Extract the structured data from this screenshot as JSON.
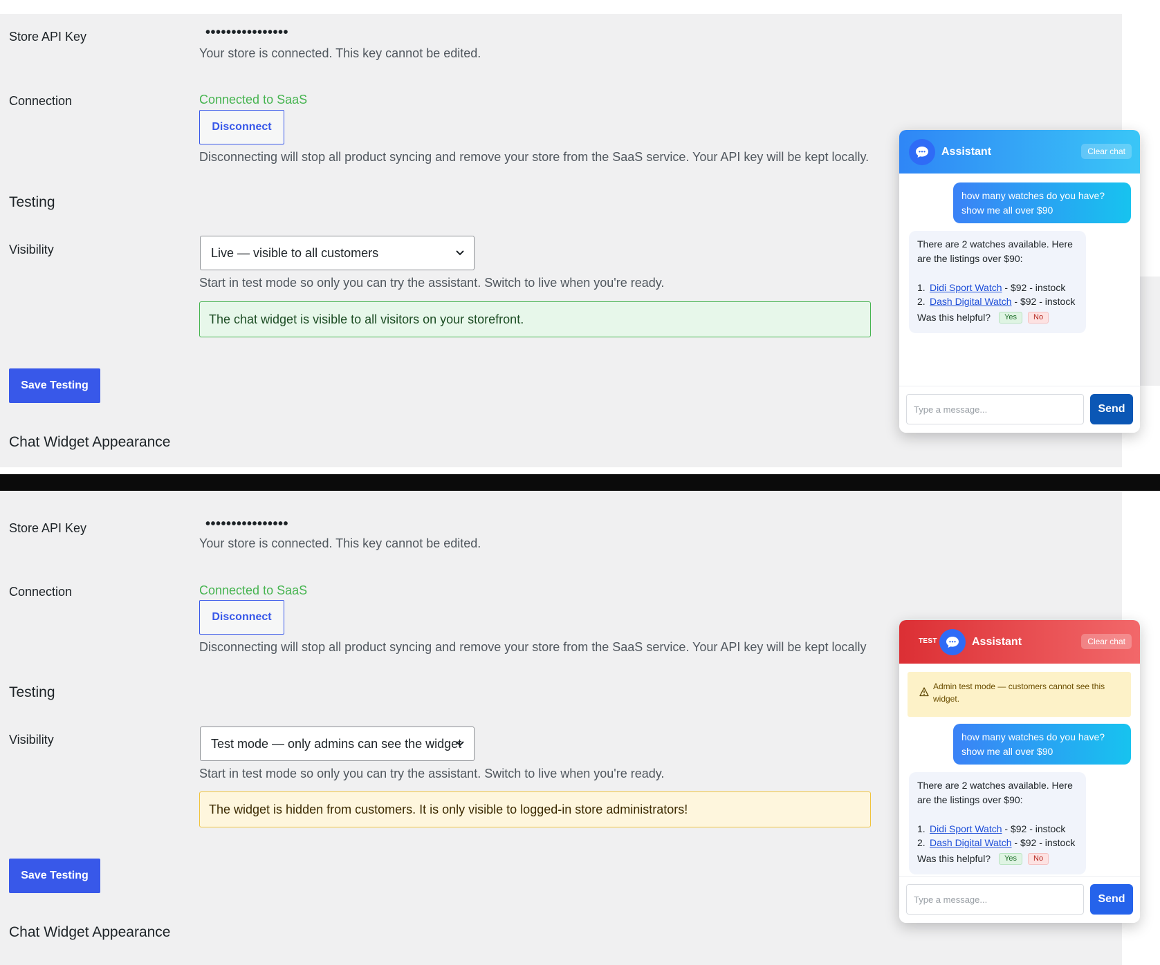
{
  "settings": {
    "api_key_label": "Store API Key",
    "api_key_masked": "••••••••••••••••",
    "api_key_desc": "Your store is connected. This key cannot be edited.",
    "connection_label": "Connection",
    "connection_status": "Connected to SaaS",
    "disconnect_label": "Disconnect",
    "testing_title": "Testing",
    "visibility_label": "Visibility",
    "visibility_desc": "Start in test mode so only you can try the assistant. Switch to live when you're ready.",
    "save_label": "Save Testing",
    "appearance_title": "Chat Widget Appearance"
  },
  "top": {
    "disconnect_desc": "Disconnecting will stop all product syncing and remove your store from the SaaS service. Your API key will be kept locally.",
    "visibility_value": "Live — visible to all customers",
    "notice": "The chat widget is visible to all visitors on your storefront."
  },
  "bottom": {
    "disconnect_desc": "Disconnecting will stop all product syncing and remove your store from the SaaS service. Your API key will be kept locally",
    "visibility_value": "Test mode — only admins can see the widget",
    "notice": "The widget is hidden from customers. It is only visible to logged-in store administrators!"
  },
  "widget": {
    "title": "Assistant",
    "clear_label": "Clear chat",
    "test_tag": "TEST",
    "test_banner": "Admin test mode — customers cannot see this widget.",
    "user_message": "how many watches do you have? show me all over $90",
    "bot_intro": "There are 2 watches available. Here are the listings over $90:",
    "products": [
      {
        "num": "1.",
        "name": "Didi Sport Watch",
        "detail": " - $92 - instock"
      },
      {
        "num": "2.",
        "name": "Dash Digital Watch",
        "detail": " - $92 - instock"
      }
    ],
    "helpful_q": "Was this helpful?",
    "yes_label": "Yes",
    "no_label": "No",
    "input_placeholder": "Type a message...",
    "send_label": "Send"
  },
  "colors": {
    "accent": "#3858e9",
    "success": "#46b450",
    "live_header": "#2f86f6",
    "test_header": "#dc2f34"
  }
}
